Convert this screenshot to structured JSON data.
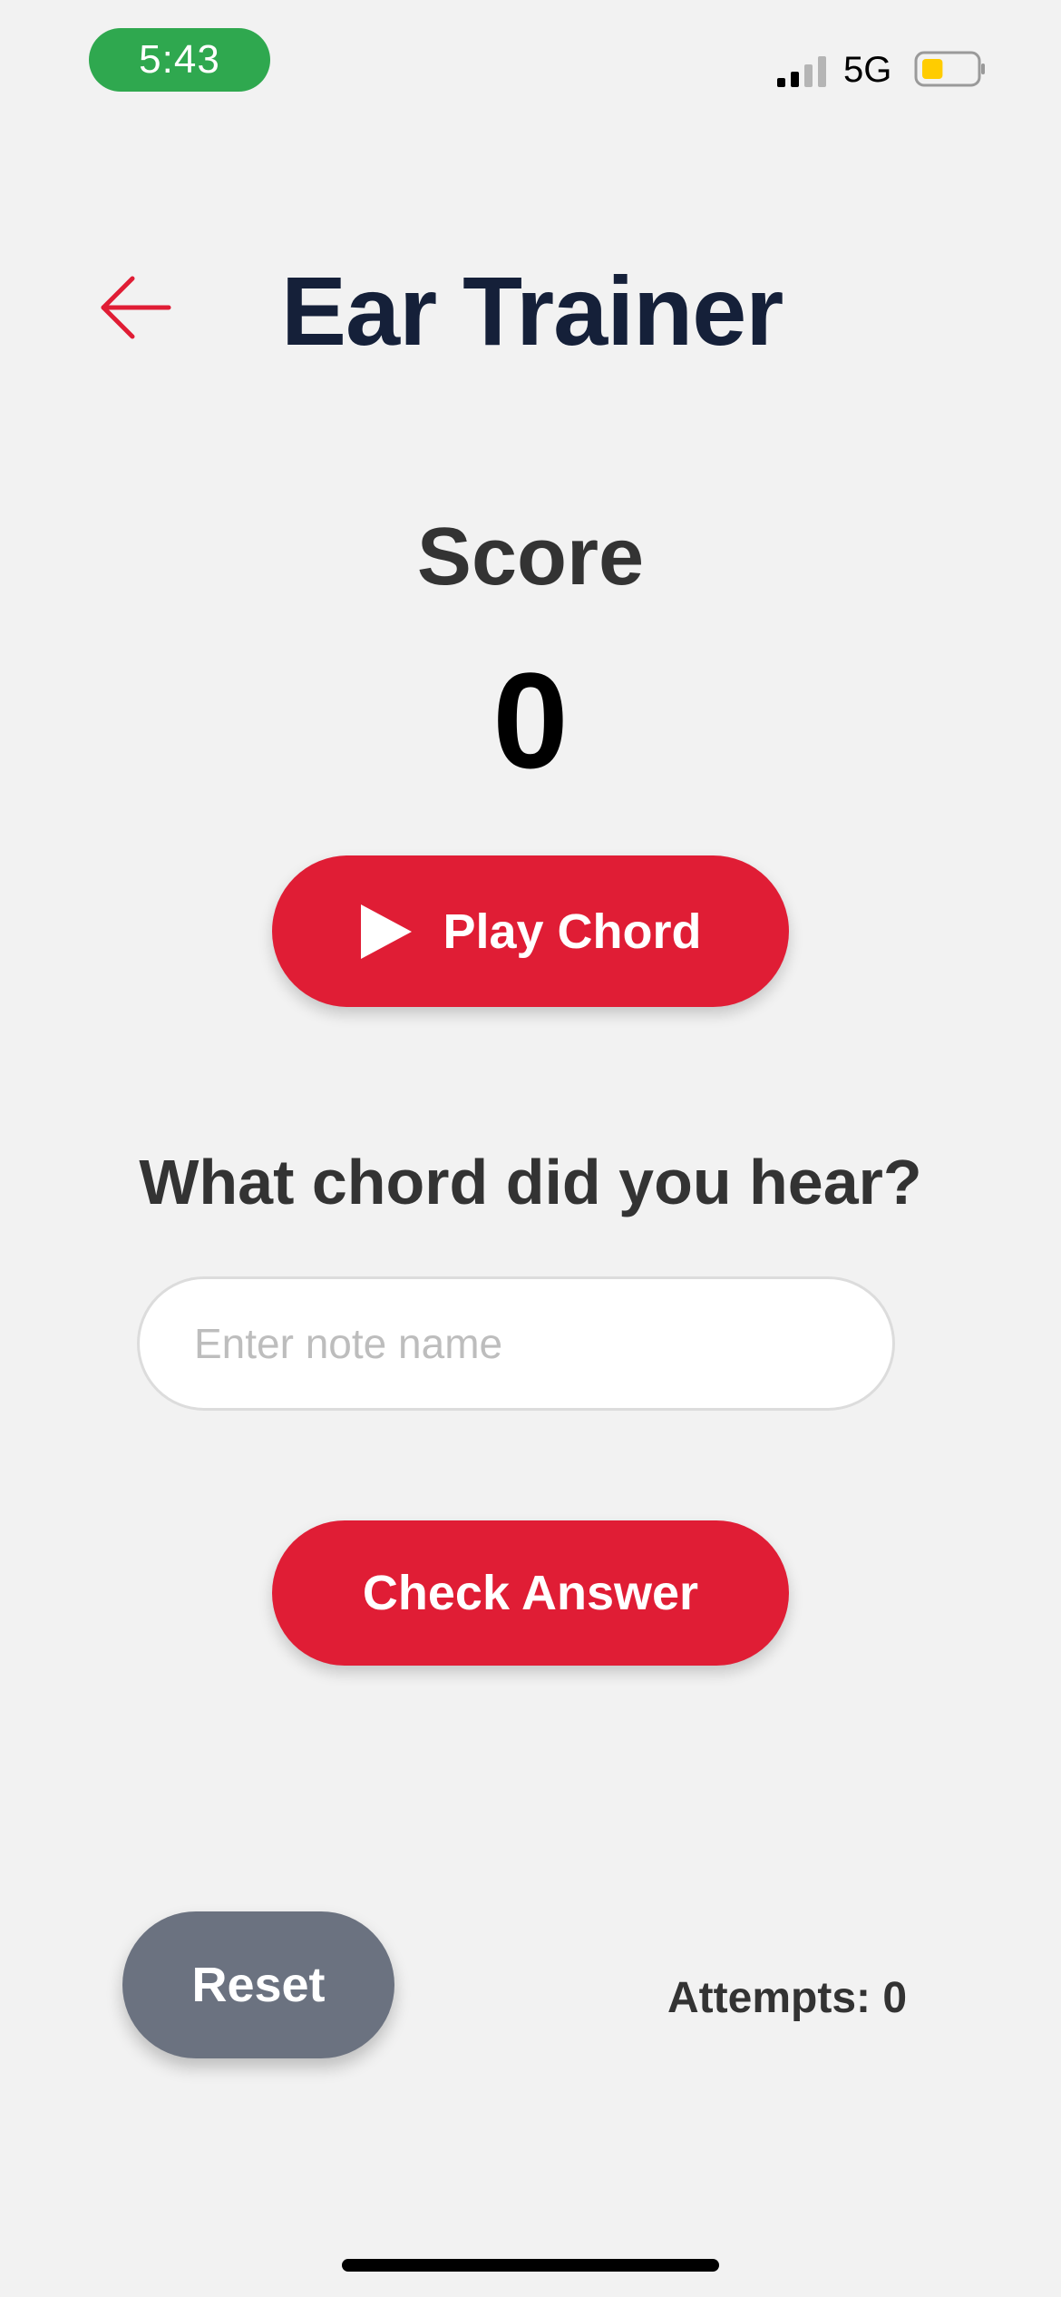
{
  "status_bar": {
    "time": "5:43",
    "network": "5G",
    "battery_level": 0.4,
    "signal_bars_active": 2,
    "signal_bars_total": 4,
    "time_pill_color": "#2fa84f",
    "battery_fill_color": "#ffcc00"
  },
  "header": {
    "title": "Ear Trainer",
    "back_icon": "arrow-left-icon",
    "accent_color": "#e01d35"
  },
  "score": {
    "label": "Score",
    "value": "0"
  },
  "play_button": {
    "label": "Play Chord",
    "icon": "play-icon"
  },
  "question": {
    "text": "What chord did you hear?"
  },
  "answer_input": {
    "placeholder": "Enter note name",
    "value": ""
  },
  "check_button": {
    "label": "Check Answer"
  },
  "footer": {
    "reset_label": "Reset",
    "attempts_text": "Attempts: 0"
  }
}
